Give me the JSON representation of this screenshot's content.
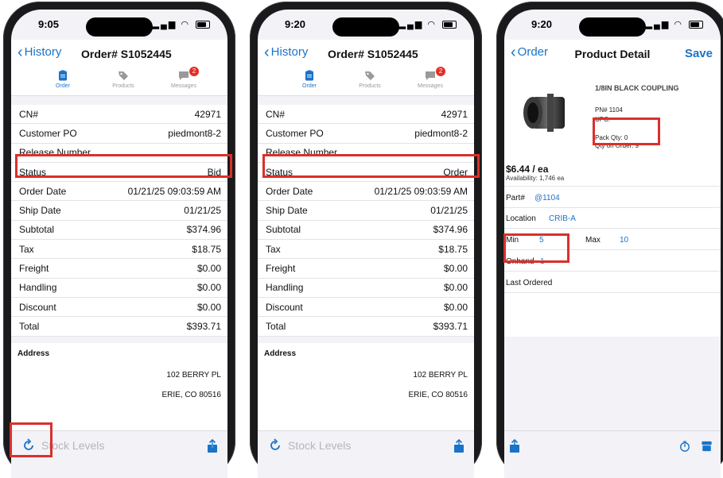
{
  "status_bar": {
    "times": [
      "9:05",
      "9:20",
      "9:20"
    ]
  },
  "order_screen": {
    "back_label": "History",
    "title": "Order# S1052445",
    "tabs": [
      {
        "label": "Order",
        "icon": "clipboard-icon"
      },
      {
        "label": "Products",
        "icon": "tag-icon"
      },
      {
        "label": "Messages",
        "icon": "message-icon",
        "badge": "2"
      }
    ],
    "rows_labels": [
      "CN#",
      "Customer PO",
      "Release Number",
      "Status",
      "Order Date",
      "Ship Date",
      "Subtotal",
      "Tax",
      "Freight",
      "Handling",
      "Discount",
      "Total"
    ],
    "rows_values_left": [
      "42971",
      "piedmont8-2",
      "",
      "Bid",
      "01/21/25 09:03:59 AM",
      "01/21/25",
      "$374.96",
      "$18.75",
      "$0.00",
      "$0.00",
      "$0.00",
      "$393.71"
    ],
    "rows_values_right": [
      "42971",
      "piedmont8-2",
      "",
      "Order",
      "01/21/25 09:03:59 AM",
      "01/21/25",
      "$374.96",
      "$18.75",
      "$0.00",
      "$0.00",
      "$0.00",
      "$393.71"
    ],
    "address_title": "Address",
    "address_line1": "102 BERRY PL",
    "address_line2": "ERIE, CO 80516",
    "toolbar_label": "Stock Levels"
  },
  "product_screen": {
    "back_label": "Order",
    "title": "Product Detail",
    "save_label": "Save",
    "product_name": "1/8IN BLACK COUPLING",
    "pn": "PN# 1104",
    "upc": "UPC:",
    "pack_qty": "Pack Qty: 0",
    "qty_on_order": "Qty on Order: 9",
    "price": "$6.44 / ea",
    "availability": "Availability: 1,746 ea",
    "part_label": "Part#",
    "part_value": "@1104",
    "location_label": "Location",
    "location_value": "CRIB-A",
    "min_label": "Min",
    "min_value": "5",
    "max_label": "Max",
    "max_value": "10",
    "onhand_label": "Onhand",
    "onhand_value": "1",
    "last_ordered_label": "Last Ordered"
  },
  "colors": {
    "accent": "#1a73c8",
    "highlight": "#d9302b",
    "badge": "#e52d27"
  }
}
